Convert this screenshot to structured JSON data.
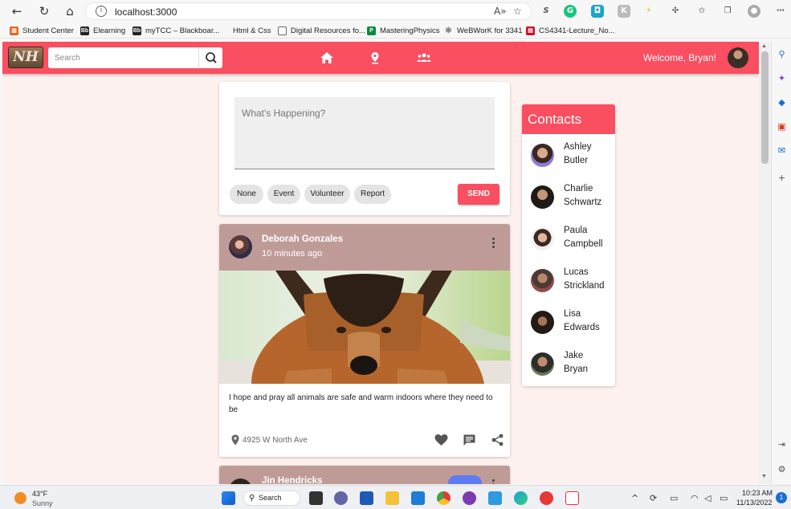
{
  "browser": {
    "url": "localhost:3000",
    "bookmarks": [
      {
        "label": "Student Center",
        "icon": "grid-icon",
        "color": "#e8641c"
      },
      {
        "label": "Elearning",
        "icon": "blackboard-icon",
        "color": "#222222"
      },
      {
        "label": "myTCC – Blackboar...",
        "icon": "blackboard-icon",
        "color": "#222222"
      },
      {
        "label": "Html & Css",
        "icon": "",
        "color": ""
      },
      {
        "label": "Digital Resources fo...",
        "icon": "document-icon",
        "color": "#666666"
      },
      {
        "label": "MasteringPhysics",
        "icon": "pearson-icon",
        "color": "#0a8a3c"
      },
      {
        "label": "WeBWorK for 3341",
        "icon": "webwork-icon",
        "color": "#888888"
      },
      {
        "label": "CS4341-Lecture_No...",
        "icon": "pdf-icon",
        "color": "#c8102e"
      }
    ]
  },
  "app": {
    "logo_text": "NH",
    "search_placeholder": "Search",
    "welcome": "Welcome, Bryan!",
    "brand_color": "#fa4e61"
  },
  "compose": {
    "placeholder": "What's Happening?",
    "chips": [
      "None",
      "Event",
      "Volunteer",
      "Report"
    ],
    "send_label": "SEND"
  },
  "post": {
    "author": "Deborah Gonzales",
    "time": "10 minutes ago",
    "text": "I hope and pray all animals are safe and warm indoors where they need to be",
    "location": "4925 W North Ave"
  },
  "post2": {
    "author": "Jin Hendricks"
  },
  "contacts": {
    "title": "Contacts",
    "people": [
      {
        "first": "Ashley",
        "last": "Butler"
      },
      {
        "first": "Charlie",
        "last": "Schwartz"
      },
      {
        "first": "Paula",
        "last": "Campbell"
      },
      {
        "first": "Lucas",
        "last": "Strickland"
      },
      {
        "first": "Lisa",
        "last": "Edwards"
      },
      {
        "first": "Jake",
        "last": "Bryan"
      }
    ]
  },
  "taskbar": {
    "temp": "43°F",
    "weather": "Sunny",
    "search_label": "Search",
    "time": "10:23 AM",
    "date": "11/13/2022",
    "notifications": "1"
  }
}
